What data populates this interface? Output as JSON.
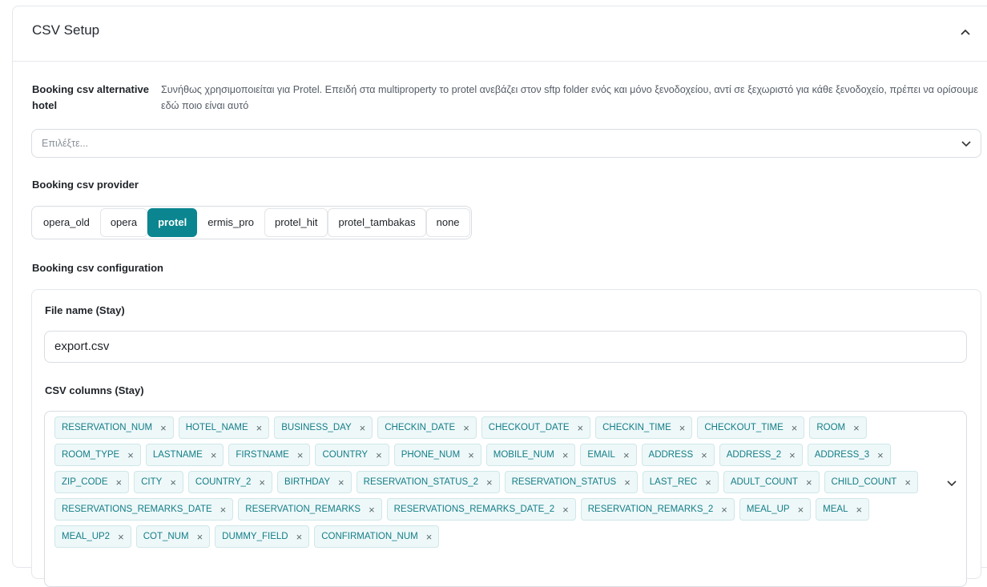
{
  "section": {
    "title": "CSV Setup"
  },
  "alt_hotel": {
    "label": "Booking csv alternative hotel",
    "description": "Συνήθως χρησιμοποιείται για Protel. Επειδή στα multiproperty το protel ανεβάζει στον sftp folder ενός και μόνο ξενοδοχείου, αντί σε ξεχωριστό για κάθε ξενοδοχείο, πρέπει να ορίσουμε εδώ ποιο είναι αυτό",
    "placeholder": "Επιλέξτε..."
  },
  "provider": {
    "label": "Booking csv provider",
    "options": [
      "opera_old",
      "opera",
      "protel",
      "ermis_pro",
      "protel_hit",
      "protel_tambakas",
      "none"
    ],
    "selected": "protel"
  },
  "configuration": {
    "label": "Booking csv configuration",
    "file_name_label": "File name (Stay)",
    "file_name_value": "export.csv",
    "columns_label": "CSV columns (Stay)",
    "columns": [
      "RESERVATION_NUM",
      "HOTEL_NAME",
      "BUSINESS_DAY",
      "CHECKIN_DATE",
      "CHECKOUT_DATE",
      "CHECKIN_TIME",
      "CHECKOUT_TIME",
      "ROOM",
      "ROOM_TYPE",
      "LASTNAME",
      "FIRSTNAME",
      "COUNTRY",
      "PHONE_NUM",
      "MOBILE_NUM",
      "EMAIL",
      "ADDRESS",
      "ADDRESS_2",
      "ADDRESS_3",
      "ZIP_CODE",
      "CITY",
      "COUNTRY_2",
      "BIRTHDAY",
      "RESERVATION_STATUS_2",
      "RESERVATION_STATUS",
      "LAST_REC",
      "ADULT_COUNT",
      "CHILD_COUNT",
      "RESERVATIONS_REMARKS_DATE",
      "RESERVATION_REMARKS",
      "RESERVATIONS_REMARKS_DATE_2",
      "RESERVATION_REMARKS_2",
      "MEAL_UP",
      "MEAL",
      "MEAL_UP2",
      "COT_NUM",
      "DUMMY_FIELD",
      "CONFIRMATION_NUM"
    ],
    "remove_glyph": "×"
  },
  "icons": {
    "collapse": "chevron-up-icon",
    "select_dropdown": "chevron-down-icon",
    "tags_dropdown": "chevron-down-icon"
  },
  "colors": {
    "accent": "#0b8690",
    "tag_bg": "#eef8f9",
    "tag_text": "#137d86"
  }
}
